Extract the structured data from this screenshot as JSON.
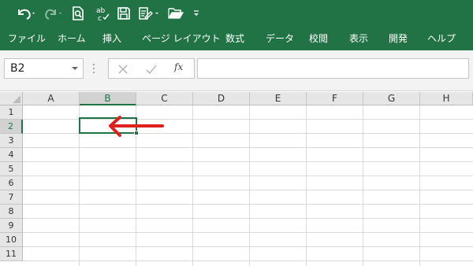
{
  "qat": {
    "items": [
      {
        "name": "undo",
        "icon": "undo-icon"
      },
      {
        "name": "redo",
        "icon": "redo-icon"
      },
      {
        "name": "print-preview",
        "icon": "print-preview-icon"
      },
      {
        "name": "spelling",
        "icon": "spelling-icon"
      },
      {
        "name": "save",
        "icon": "save-icon"
      },
      {
        "name": "form",
        "icon": "form-icon"
      },
      {
        "name": "open",
        "icon": "folder-open-icon"
      },
      {
        "name": "customize",
        "icon": "customize-toolbar-icon"
      }
    ],
    "color": "#217346"
  },
  "ribbon": {
    "tabs": [
      "ファイル",
      "ホーム",
      "挿入",
      "ページ レイアウト",
      "数式",
      "データ",
      "校閲",
      "表示",
      "開発",
      "ヘルプ"
    ]
  },
  "formula": {
    "name_box": "B2",
    "cancel_icon": "cancel-icon",
    "enter_icon": "check-icon",
    "fx_label": "fx",
    "value": ""
  },
  "grid": {
    "columns": [
      "A",
      "B",
      "C",
      "D",
      "E",
      "F",
      "G",
      "H"
    ],
    "rows": [
      "1",
      "2",
      "3",
      "4",
      "5",
      "6",
      "7",
      "8",
      "9",
      "10",
      "11"
    ],
    "selected_column": "B",
    "selected_row": "2",
    "annotation": "red-arrow-pointing-at-B2",
    "annotation_color": "#e0201c",
    "accent": "#217346"
  }
}
